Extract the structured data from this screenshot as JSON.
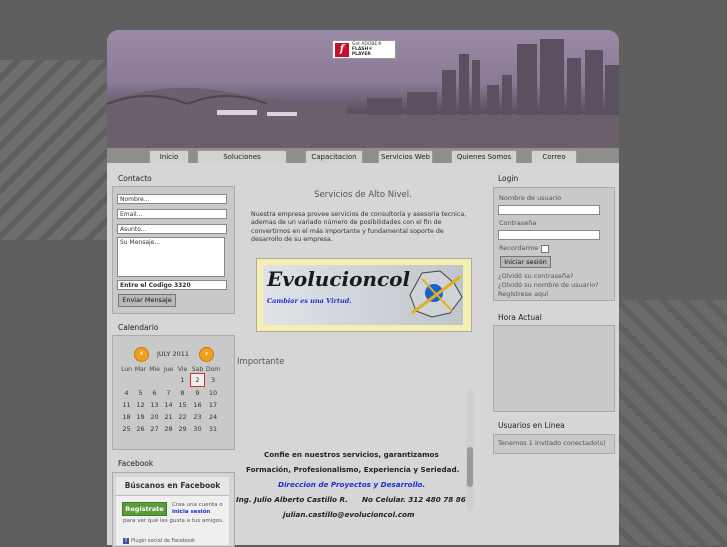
{
  "flash_badge": {
    "line1": "Get ADOBE®",
    "line2": "FLASH® PLAYER"
  },
  "nav": [
    "Inicio",
    "Soluciones Empresariales",
    "Capacitacion",
    "Servicios Web",
    "Quienes Somos",
    "Correo"
  ],
  "contact": {
    "title": "Contacto",
    "name_placeholder": "Nombre...",
    "email_placeholder": "Email...",
    "subject_placeholder": "Asunto...",
    "message_placeholder": "Su Mensaje...",
    "code_label": "Entre el Codigo 3320",
    "send_label": "Enviar Mensaje"
  },
  "calendar": {
    "title": "Calendario",
    "month": "JULY 2011",
    "days": [
      "Lun",
      "Mar",
      "Mie",
      "Jue",
      "Vie",
      "Sab",
      "Dom"
    ],
    "weeks": [
      [
        "",
        "",
        "",
        "",
        "1",
        "2",
        "3"
      ],
      [
        "4",
        "5",
        "6",
        "7",
        "8",
        "9",
        "10"
      ],
      [
        "11",
        "12",
        "13",
        "14",
        "15",
        "16",
        "17"
      ],
      [
        "18",
        "19",
        "20",
        "21",
        "22",
        "23",
        "24"
      ],
      [
        "25",
        "26",
        "27",
        "28",
        "29",
        "30",
        "31"
      ]
    ],
    "today": "2"
  },
  "facebook": {
    "title": "Facebook",
    "header": "Búscanos en Facebook",
    "register": "Regístrate",
    "text1": "Crea una cuenta o",
    "login_link": "inicia sesión",
    "text2": "para ver qué les gusta a tus amigos.",
    "plugin": "Plugin social de Facebook"
  },
  "main": {
    "heading": "Servicios de Alto Nivel.",
    "paragraph": "Nuestra empresa provee servicios de consultoría y asesoría tecnica, ademas de un variado número de posibilidades con el fin de convertirnos en el más importante y fundamental soporte de desarrollo de su empresa.",
    "banner_title": "Evolucioncol",
    "banner_tagline": "Cambiar es una Virtud.",
    "important": "Importante",
    "line1": "Confie en nuestros servicios, garantizamos",
    "line2": "Formación, Profesionalismo, Experiencia y Seriedad.",
    "line3": "Direccion de Proyectos y Desarrollo.",
    "line4a": "Ing. Julio Alberto Castillo R.",
    "line4b": "No Celular. 312 480 78 86",
    "line5": "julian.castillo@evolucioncol.com"
  },
  "login": {
    "title": "Login",
    "user_label": "Nombre de usuario",
    "pass_label": "Contraseña",
    "remember": "Recordarme",
    "submit": "Iniciar sesión",
    "forgot_pass": "¿Olvidó su contraseña?",
    "forgot_user": "¿Olvidó su nombre de usuario?",
    "register": "Regístrese aquí"
  },
  "hora": {
    "title": "Hora Actual"
  },
  "online": {
    "title": "Usuarios en Linea",
    "text": "Tenemos 1 invitado conectado(s)"
  },
  "colors": {
    "accent": "#f0a020",
    "link_blue": "#1a2fd0",
    "facebook_green": "#5b9a3a"
  }
}
